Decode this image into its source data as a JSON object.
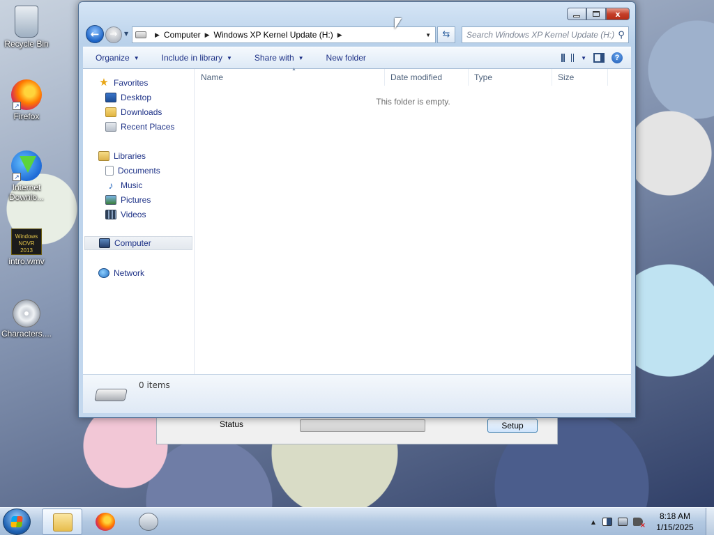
{
  "desktop": {
    "icons": [
      {
        "label": "Recycle Bin"
      },
      {
        "label": "Firefox"
      },
      {
        "label": "Internet Downlo..."
      },
      {
        "label": "intro.wmv",
        "thumb_text": "Windows NOVR 2013"
      },
      {
        "label": "Characters...."
      }
    ]
  },
  "background_dialog": {
    "status_label": "Status",
    "progress": 0,
    "setup_button": "Setup"
  },
  "window": {
    "caption": {
      "min": "",
      "max": "",
      "close": "x"
    },
    "nav": {
      "back": "←",
      "forward": "→"
    },
    "address": {
      "crumbs": [
        "Computer",
        "Windows XP Kernel Update (H:)"
      ]
    },
    "search": {
      "placeholder": "Search Windows XP Kernel Update (H:)"
    },
    "toolbar": {
      "organize": "Organize",
      "include": "Include in library",
      "share": "Share with",
      "new_folder": "New folder"
    },
    "navpane": {
      "favorites": "Favorites",
      "desktop": "Desktop",
      "downloads": "Downloads",
      "recent": "Recent Places",
      "libraries": "Libraries",
      "documents": "Documents",
      "music": "Music",
      "pictures": "Pictures",
      "videos": "Videos",
      "computer": "Computer",
      "network": "Network"
    },
    "columns": [
      "Name",
      "Date modified",
      "Type",
      "Size"
    ],
    "empty_message": "This folder is empty.",
    "details": {
      "items": "0 items"
    }
  },
  "taskbar": {
    "clock_time": "8:18 AM",
    "clock_date": "1/15/2025"
  },
  "colors": {
    "link_blue": "#1e3287",
    "window_frame": "#b9d1ea",
    "close_red": "#c4402a"
  }
}
